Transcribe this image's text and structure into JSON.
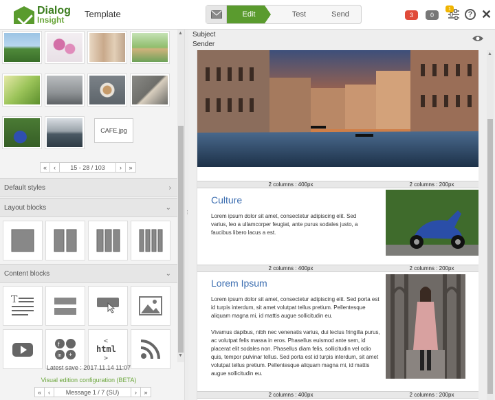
{
  "header": {
    "logo_line1": "Dialog",
    "logo_line2": "Insight",
    "app_title": "Template",
    "steps": {
      "edit": "Edit",
      "test": "Test",
      "send": "Send"
    },
    "badges": {
      "red": "3",
      "grey": "0",
      "yellow": "1"
    },
    "colors": {
      "brand_green": "#5a9b2e",
      "badge_red": "#e04b3a"
    }
  },
  "library": {
    "tooltip": "CAFE.jpg",
    "pager": {
      "first": "«",
      "prev": "‹",
      "range": "15 - 28 / 103",
      "next": "›",
      "last": "»"
    }
  },
  "sections": {
    "default_styles": "Default styles",
    "layout_blocks": "Layout blocks",
    "content_blocks": "Content blocks"
  },
  "footer": {
    "latest_save": "Latest save : 2017.11.14 11:07",
    "visual_config": "Visual edition configuration (BETA)",
    "pager": {
      "first": "«",
      "prev": "‹",
      "label": "Message 1 / 7 (SU)",
      "next": "›",
      "last": "»"
    }
  },
  "meta": {
    "subject_label": "Subject",
    "sender_label": "Sender"
  },
  "email": {
    "col_400": "2 columns : 400px",
    "col_200": "2 columns : 200px",
    "culture_title": "Culture",
    "culture_text": "Lorem ipsum dolor sit amet, consectetur adipiscing elit. Sed varius, leo a ullamcorper feugiat, ante purus sodales justo, a faucibus libero lacus a est.",
    "lorem_title": "Lorem Ipsum",
    "lorem_text1": "Lorem ipsum dolor sit amet, consectetur adipiscing elit. Sed porta est id turpis interdum, sit amet volutpat tellus pretium. Pellentesque aliquam magna mi, id mattis augue sollicitudin eu.",
    "lorem_text2": "Vivamus dapibus, nibh nec venenatis varius, dui lectus fringilla purus, ac volutpat felis massa in eros. Phasellus euismod ante sem, id placerat elit sodales non. Phasellus diam felis, sollicitudin vel odio quis, tempor pulvinar tellus. Sed porta est id turpis interdum, sit amet volutpat tellus pretium. Pellentesque aliquam magna mi, id mattis augue sollicitudin eu."
  }
}
